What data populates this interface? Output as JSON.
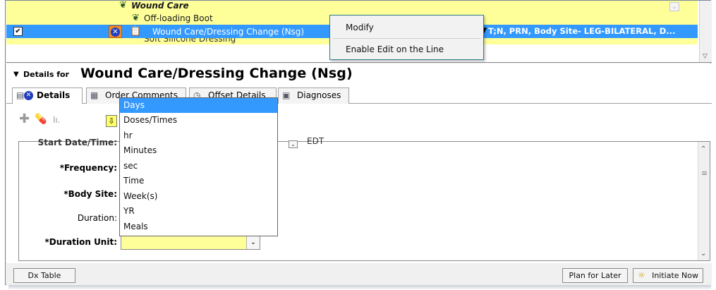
{
  "orders": {
    "rows": [
      {
        "label": "Wound Care",
        "icon": "segment-icon"
      },
      {
        "label": "Off-loading Boot",
        "icon": "segment-icon"
      },
      {
        "label": "Wound Care/Dressing Change (Nsg)",
        "checked": true,
        "details": "T;N, PRN, Body Site- LEG-BILATERAL, D..."
      },
      {
        "label": "Soft Silicone Dressing"
      }
    ]
  },
  "context_menu": {
    "items": [
      "Modify",
      "Enable Edit on the Line"
    ]
  },
  "details": {
    "prefix": "Details for",
    "title": "Wound Care/Dressing Change (Nsg)"
  },
  "tabs": [
    "Details",
    "Order Comments",
    "Offset Details",
    "Diagnoses"
  ],
  "fields": {
    "start": {
      "label": "Start Date/Time:",
      "value_suffix": "EDT"
    },
    "frequency": {
      "label": "*Frequency:"
    },
    "body_site": {
      "label": "*Body Site:"
    },
    "duration": {
      "label": "Duration:"
    },
    "duration_unit": {
      "label": "*Duration Unit:",
      "value": ""
    }
  },
  "duration_unit_options": [
    "Days",
    "Doses/Times",
    "hr",
    "Minutes",
    "sec",
    "Time",
    "Week(s)",
    "YR",
    "Meals"
  ],
  "duration_unit_selected": "Days",
  "footer": {
    "dx_table": "Dx Table",
    "plan_for_later": "Plan for Later",
    "initiate_now": "Initiate Now"
  },
  "colors": {
    "row_highlight": "#ffff99",
    "selection": "#3399ff",
    "remove_button": "#f08a2a"
  }
}
